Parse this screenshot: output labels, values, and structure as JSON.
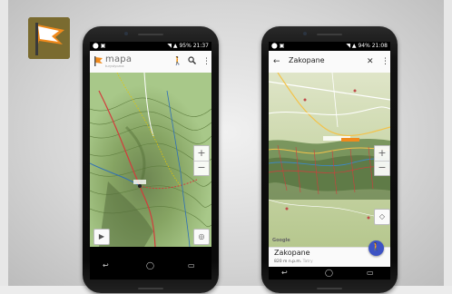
{
  "colors": {
    "topo_green": "#8fb56a",
    "route_red": "#d23c3c",
    "fab_blue": "#3d53c4",
    "logo_olive": "#7a6b30"
  },
  "logo": {
    "icon": "flag-icon"
  },
  "phone_left": {
    "status": {
      "time": "21:37",
      "battery": "95%"
    },
    "app": {
      "brand_name": "mapa",
      "brand_sub": "turystyczna",
      "hiker_icon": "hiker-icon",
      "search_icon": "search-icon",
      "menu_icon": "more-vert-icon"
    },
    "zoom": {
      "in": "+",
      "out": "−"
    },
    "controls": {
      "play": "play-icon",
      "locate": "locate-icon"
    },
    "nav": {
      "back": "back-icon",
      "home": "home-icon",
      "recents": "recents-icon"
    }
  },
  "phone_right": {
    "status": {
      "time": "21:08",
      "battery": "94%"
    },
    "search": {
      "query": "Zakopane",
      "back_icon": "arrow-left-icon",
      "clear_icon": "close-icon",
      "menu_icon": "more-vert-icon"
    },
    "zoom": {
      "in": "+",
      "out": "−"
    },
    "google": "Google",
    "place": {
      "name": "Zakopane",
      "elevation": "820 m n.p.m.",
      "region": "Tatry"
    },
    "fab_icon": "hiker-icon",
    "nav": {
      "back": "back-icon",
      "home": "home-icon",
      "recents": "recents-icon"
    }
  }
}
